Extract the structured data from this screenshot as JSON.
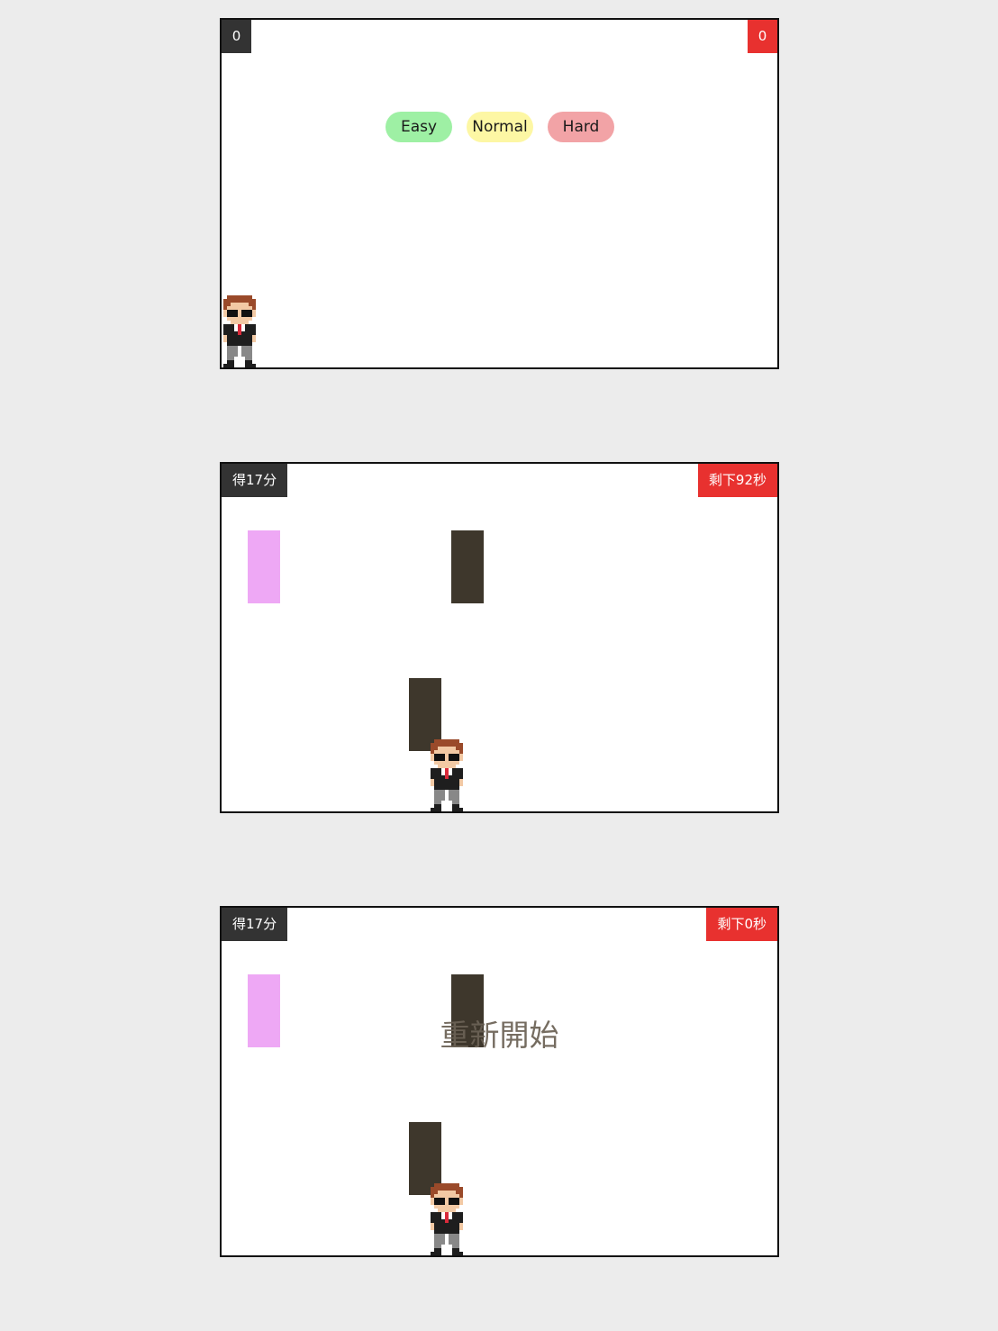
{
  "screens": [
    {
      "score_label": "0",
      "time_label": "0",
      "difficulty_buttons": [
        {
          "label": "Easy",
          "color": "#9ef0a4"
        },
        {
          "label": "Normal",
          "color": "#fdf7a4"
        },
        {
          "label": "Hard",
          "color": "#f2a3a6"
        }
      ]
    },
    {
      "score_label": "得17分",
      "time_label": "剩下92秒"
    },
    {
      "score_label": "得17分",
      "time_label": "剩下0秒",
      "restart_label": "重新開始"
    }
  ],
  "colors": {
    "score_bg": "#333333",
    "time_bg": "#e8312f",
    "bonus_block": "#eea8f5",
    "obstacle_block": "#3e372c",
    "game_bg": "#ffffff",
    "page_bg": "#ececec"
  },
  "icons": {
    "player": "pixel-agent-character",
    "bonus_block": "pink-block",
    "obstacle_block": "dark-block"
  }
}
